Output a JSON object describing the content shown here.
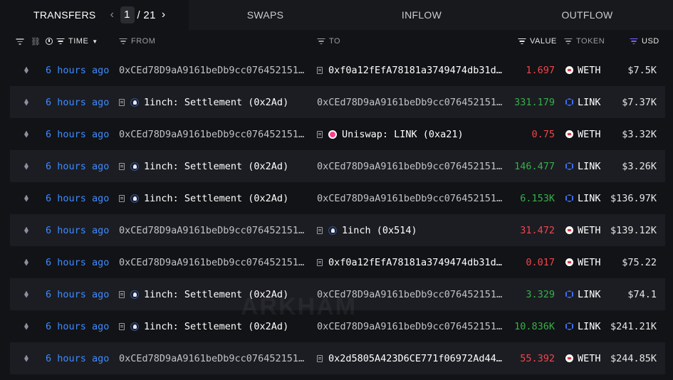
{
  "tabs": {
    "transfers": "TRANSFERS",
    "page_current": "1",
    "page_total": "/ 21",
    "swaps": "SWAPS",
    "inflow": "INFLOW",
    "outflow": "OUTFLOW"
  },
  "headers": {
    "time": "TIME",
    "from": "FROM",
    "to": "TO",
    "value": "VALUE",
    "token": "TOKEN",
    "usd": "USD"
  },
  "watermark": "ARKHAM",
  "colors": {
    "link_blue": "#3d8bff",
    "negative": "#f0454c",
    "positive": "#36b04a",
    "usd_filter": "#7b61ff"
  },
  "rows": [
    {
      "time": "6 hours ago",
      "from": "0xCEd78D9aA9161beDb9cc076452151…",
      "to": "0xf0a12fEfA78181a3749474db31d…",
      "value": "1.697",
      "token": "WETH",
      "usd": "$7.5K"
    },
    {
      "time": "6 hours ago",
      "from": "1inch: Settlement (0x2Ad)",
      "to": "0xCEd78D9aA9161beDb9cc076452151…",
      "value": "331.179",
      "token": "LINK",
      "usd": "$7.37K"
    },
    {
      "time": "6 hours ago",
      "from": "0xCEd78D9aA9161beDb9cc076452151…",
      "to": "Uniswap: LINK (0xa21)",
      "value": "0.75",
      "token": "WETH",
      "usd": "$3.32K"
    },
    {
      "time": "6 hours ago",
      "from": "1inch: Settlement (0x2Ad)",
      "to": "0xCEd78D9aA9161beDb9cc076452151…",
      "value": "146.477",
      "token": "LINK",
      "usd": "$3.26K"
    },
    {
      "time": "6 hours ago",
      "from": "1inch: Settlement (0x2Ad)",
      "to": "0xCEd78D9aA9161beDb9cc076452151…",
      "value": "6.153K",
      "token": "LINK",
      "usd": "$136.97K"
    },
    {
      "time": "6 hours ago",
      "from": "0xCEd78D9aA9161beDb9cc076452151…",
      "to": "1inch (0x514)",
      "value": "31.472",
      "token": "WETH",
      "usd": "$139.12K"
    },
    {
      "time": "6 hours ago",
      "from": "0xCEd78D9aA9161beDb9cc076452151…",
      "to": "0xf0a12fEfA78181a3749474db31d…",
      "value": "0.017",
      "token": "WETH",
      "usd": "$75.22"
    },
    {
      "time": "6 hours ago",
      "from": "1inch: Settlement (0x2Ad)",
      "to": "0xCEd78D9aA9161beDb9cc076452151…",
      "value": "3.329",
      "token": "LINK",
      "usd": "$74.1"
    },
    {
      "time": "6 hours ago",
      "from": "1inch: Settlement (0x2Ad)",
      "to": "0xCEd78D9aA9161beDb9cc076452151…",
      "value": "10.836K",
      "token": "LINK",
      "usd": "$241.21K"
    },
    {
      "time": "6 hours ago",
      "from": "0xCEd78D9aA9161beDb9cc076452151…",
      "to": "0x2d5805A423D6CE771f06972Ad44…",
      "value": "55.392",
      "token": "WETH",
      "usd": "$244.85K"
    }
  ]
}
